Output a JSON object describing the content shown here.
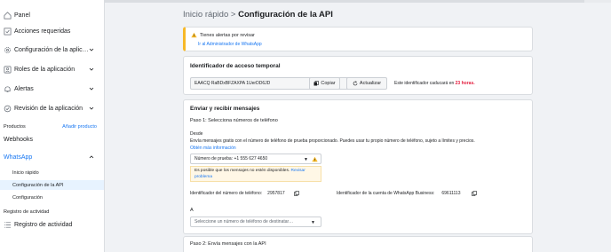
{
  "sidebar": {
    "items": [
      {
        "label": "Panel",
        "icon": "home-icon"
      },
      {
        "label": "Acciones requeridas",
        "icon": "checklist-icon"
      },
      {
        "label": "Configuración de la aplic…",
        "icon": "gear-icon",
        "expandable": true
      },
      {
        "label": "Roles de la aplicación",
        "icon": "roles-icon",
        "expandable": true
      },
      {
        "label": "Alertas",
        "icon": "bell-icon",
        "expandable": true
      },
      {
        "label": "Revisión de la aplicación",
        "icon": "check-circle-icon",
        "expandable": true
      }
    ],
    "products_label": "Productos",
    "add_product_label": "Añadir producto",
    "webhooks_label": "Webhooks",
    "whatsapp_label": "WhatsApp",
    "whatsapp_sub": [
      {
        "label": "Inicio rápido",
        "active": false
      },
      {
        "label": "Configuración de la API",
        "active": true
      },
      {
        "label": "Configuración",
        "active": false
      }
    ],
    "activity_section": "Registro de actividad",
    "activity_item": "Registro de actividad"
  },
  "header": {
    "crumb": "Inicio rápido",
    "separator": ">",
    "title": "Configuración de la API"
  },
  "alert": {
    "text": "Tienes alertas por revisar",
    "link": "Ir al Administrador de WhatsApp"
  },
  "token": {
    "title": "Identificador de acceso temporal",
    "value": "EAACQ         RaBDxBFZAXPA        1UerDD6JD",
    "copy_label": "Copiar",
    "refresh_label": "Actualizar",
    "expiry_prefix": "Este identificador caducará en",
    "expiry_value": "23 horas."
  },
  "messages": {
    "title": "Enviar y recibir mensajes",
    "step1": "Paso 1: Selecciona números de teléfono",
    "from_label": "Desde",
    "description": "Envía mensajes gratis con el número de teléfono de prueba proporcionado. Puedes usar tu propio número de teléfono, sujeto a límites y precios.",
    "more_info": "Obtén más información",
    "from_value": "Número de prueba: +1 555 627 4650",
    "warning_text": "Es posible que los mensajes no estén disponibles.",
    "warning_link": "Revisar problema",
    "phone_id_label": "Identificador del número de teléfono:",
    "phone_id_value": "2957817",
    "waba_id_label": "Identificador de la cuenta de WhatsApp Business:",
    "waba_id_value": "69611113",
    "to_label": "A",
    "to_placeholder": "Seleccione un número de teléfono de destinatar…"
  },
  "step2": {
    "label": "Paso 2: Envía mensajes con la API"
  },
  "colors": {
    "accent": "#1877f2",
    "warning": "#f7b928",
    "danger": "#e41e3f",
    "active_bg": "#e7f3ff"
  }
}
